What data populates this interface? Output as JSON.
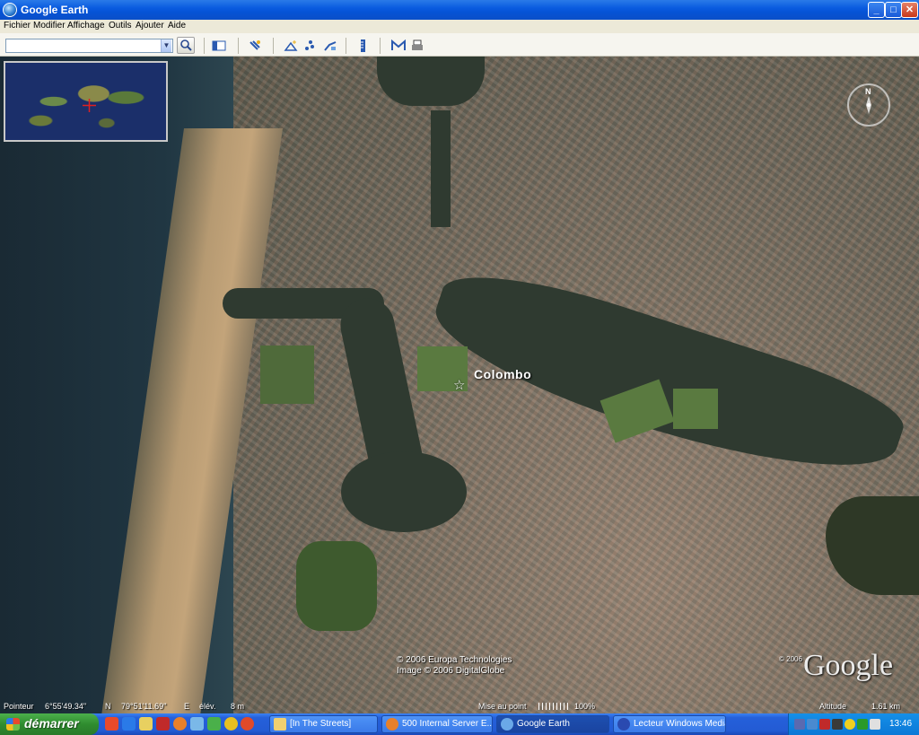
{
  "window": {
    "title": "Google Earth",
    "controls": {
      "minimize": "_",
      "maximize": "□",
      "close": "✕"
    }
  },
  "menu": {
    "items": [
      "Fichier",
      "Modifier",
      "Affichage",
      "Outils",
      "Ajouter",
      "Aide"
    ]
  },
  "toolbar": {
    "search_value": "",
    "icons": [
      "search-icon",
      "sidebar-toggle-icon",
      "hand-tool-icon",
      "add-placemark-icon",
      "add-polygon-icon",
      "add-path-icon",
      "ruler-icon",
      "email-icon",
      "print-icon"
    ]
  },
  "map": {
    "place_label": "Colombo",
    "copyright_line1": "© 2006 Europa Technologies",
    "copyright_line2": "Image © 2006 DigitalGlobe",
    "copyright_year_small": "© 2006",
    "logo_text": "Google",
    "compass_letter": "N"
  },
  "status": {
    "pointer_label": "Pointeur",
    "latitude": "6°55'49.34\"",
    "lat_hemi": "N",
    "longitude": "79°51'11.69\"",
    "lon_hemi": "E",
    "elev_label": "élév.",
    "elev_value": "8 m",
    "streaming_label": "Mise au point",
    "streaming_percent": "100%",
    "altitude_label": "Altitude",
    "altitude_value": "1.61 km"
  },
  "taskbar": {
    "start_label": "démarrer",
    "tasks": [
      "[In The Streets]",
      "500 Internal Server E...",
      "Google Earth",
      "Lecteur Windows Media"
    ],
    "active_task": "Google Earth",
    "clock": "13:46"
  },
  "colors": {
    "title_blue": "#0553d6",
    "taskbar_blue": "#235bd4",
    "start_green": "#2f8c2f",
    "tray_blue": "#0c78d6"
  }
}
